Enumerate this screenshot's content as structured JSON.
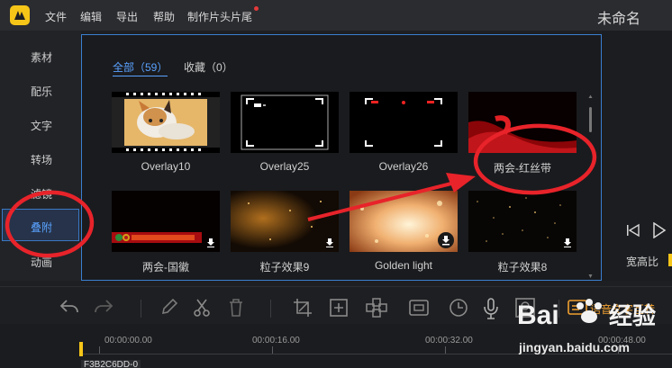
{
  "app": {
    "menu": [
      "文件",
      "编辑",
      "导出",
      "帮助",
      "制作片头片尾"
    ],
    "title": "未命名"
  },
  "sidebar": {
    "items": [
      {
        "label": "素材"
      },
      {
        "label": "配乐"
      },
      {
        "label": "文字"
      },
      {
        "label": "转场"
      },
      {
        "label": "滤镜"
      },
      {
        "label": "叠附",
        "active": true
      },
      {
        "label": "动画"
      }
    ]
  },
  "library": {
    "tabs": [
      {
        "label": "全部（59）",
        "active": true
      },
      {
        "label": "收藏（0）"
      }
    ],
    "items": [
      {
        "label": "Overlay10",
        "thumb": "kitten-filmstrip"
      },
      {
        "label": "Overlay25",
        "thumb": "camera-frame"
      },
      {
        "label": "Overlay26",
        "thumb": "recording-frame"
      },
      {
        "label": "两会-红丝带",
        "thumb": "red-ribbon"
      },
      {
        "label": "两会-国徽",
        "thumb": "emblem-banner",
        "download": true
      },
      {
        "label": "粒子效果9",
        "thumb": "golden-particles",
        "download": true
      },
      {
        "label": "Golden light",
        "thumb": "golden-light",
        "download": true
      },
      {
        "label": "粒子效果8",
        "thumb": "dark-particles",
        "download": true
      }
    ]
  },
  "preview": {
    "ratio_label": "宽高比"
  },
  "toolbar": {
    "speech_label": "语音文字互转"
  },
  "timeline": {
    "times": [
      "00:00:00.00",
      "00:00:16.00",
      "00:00:32.00",
      "00:00:48.00"
    ],
    "clip_label": "F3B2C6DD-0"
  },
  "watermark": {
    "logo_text": "Bai",
    "logo_suffix": "经验",
    "url": "jingyan.baidu.com"
  },
  "colors": {
    "accent": "#5aa2ff",
    "annotation": "#e8232a",
    "brand": "#f5c518"
  }
}
